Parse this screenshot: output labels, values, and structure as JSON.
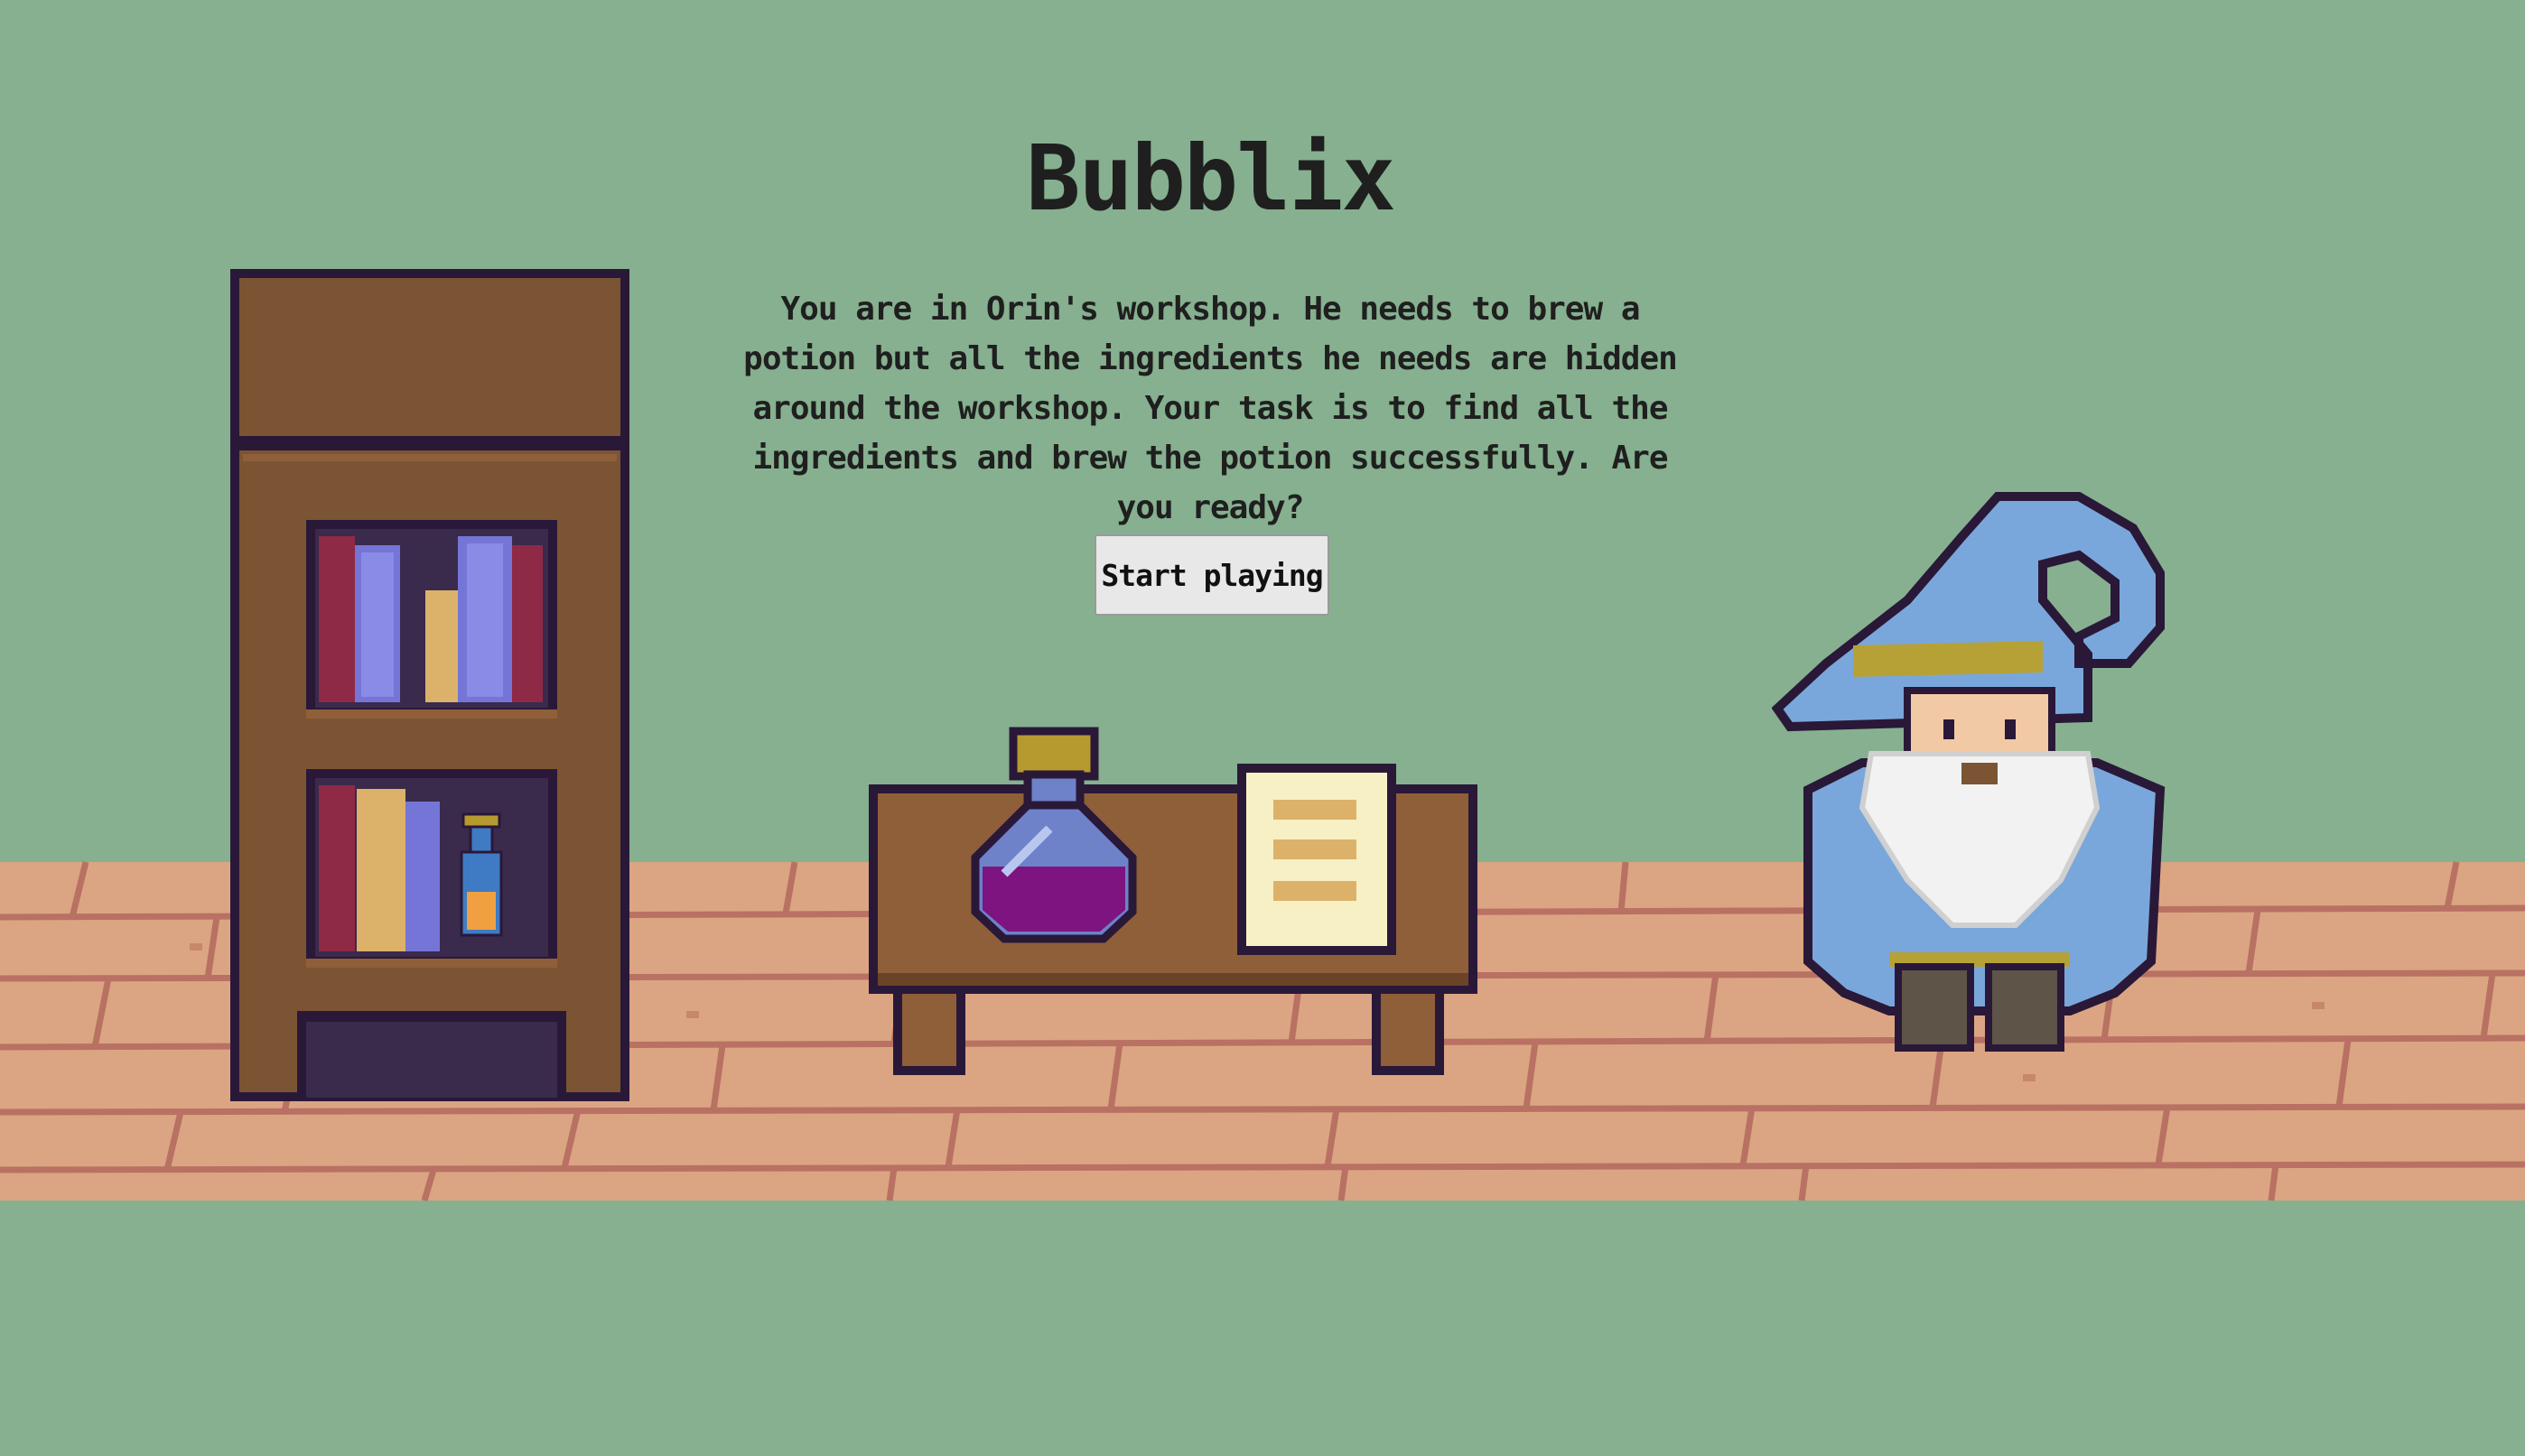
{
  "game": {
    "title": "Bubblix",
    "intro": "You are in Orin's workshop. He needs to brew a potion but all the ingredients he needs are hidden around the workshop. Your task is to find all the ingredients and brew the potion successfully. Are you ready?",
    "start_button_label": "Start playing"
  },
  "scene": {
    "objects": [
      "bookshelf",
      "potion-table",
      "wizard"
    ],
    "icons": {
      "bookshelf": "bookshelf-icon",
      "books": "book-icon",
      "small_bottle": "bottle-icon",
      "potion": "potion-flask-icon",
      "recipe": "recipe-scroll-icon",
      "wizard": "wizard-icon"
    }
  },
  "colors": {
    "background": "#86b08f",
    "floor": "#dba583",
    "floor_lines": "#b87162",
    "outline": "#2a1838",
    "wood": "#7b5433",
    "wood_light": "#8f5f3a",
    "book_red": "#8e2a45",
    "book_blue": "#7475d6",
    "book_yellow": "#dcb26a",
    "potion_purple": "#7d1480",
    "flask_glass": "#6d82c9",
    "cork": "#b59a2f",
    "paper": "#f7f0c4",
    "wizard_blue": "#7aa7db",
    "wizard_band": "#b6a136",
    "beard": "#f2f2f2",
    "text": "#1f1f1f",
    "button_bg": "#e8e8e8"
  }
}
